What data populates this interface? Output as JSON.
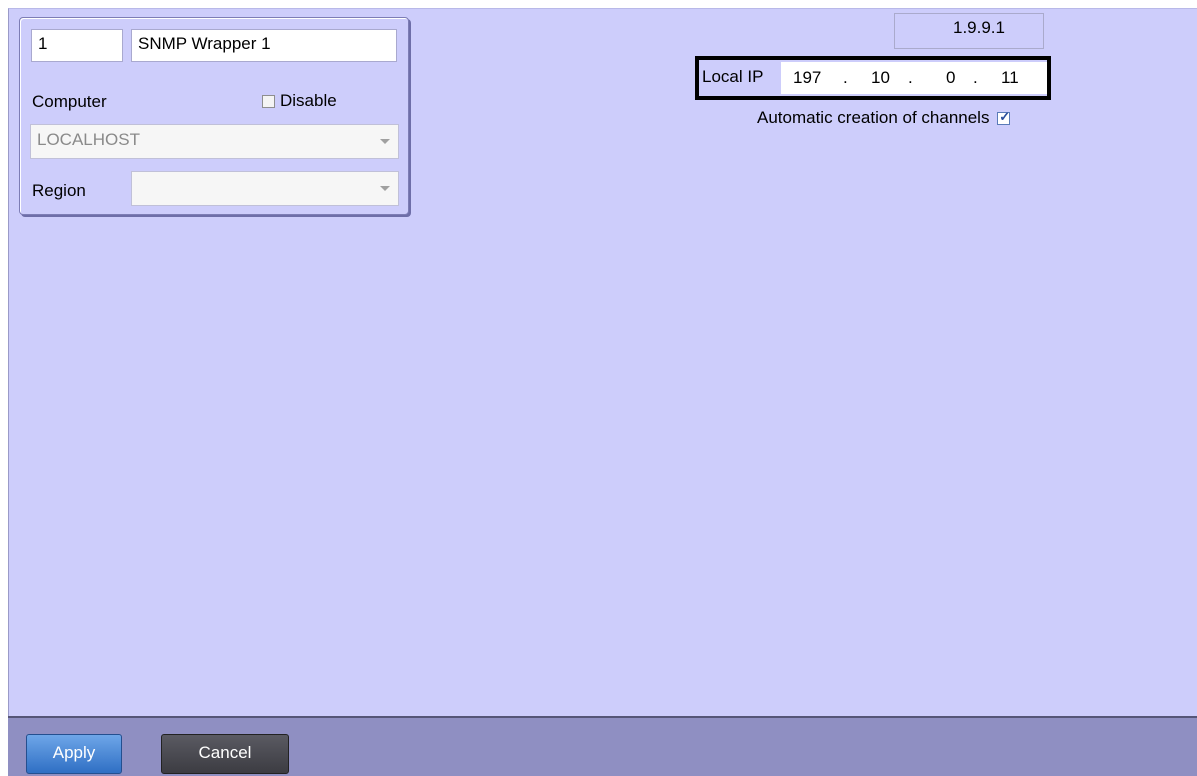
{
  "object": {
    "id": "1",
    "name": "SNMP Wrapper 1",
    "computer_label": "Computer",
    "disable_label": "Disable",
    "disable_checked": false,
    "computer_value": "LOCALHOST",
    "region_label": "Region",
    "region_value": ""
  },
  "version": "1.9.9.1",
  "local_ip": {
    "label": "Local IP",
    "octets": [
      "197",
      "10",
      "0",
      "11"
    ]
  },
  "auto_channels": {
    "label": "Automatic creation of channels",
    "checked": true
  },
  "footer": {
    "apply_label": "Apply",
    "cancel_label": "Cancel"
  },
  "colors": {
    "panel_bg": "#cdcdfb",
    "footer_bg": "#8f8fc2",
    "apply_bg": "#3c7fd6",
    "cancel_bg": "#45454c"
  }
}
